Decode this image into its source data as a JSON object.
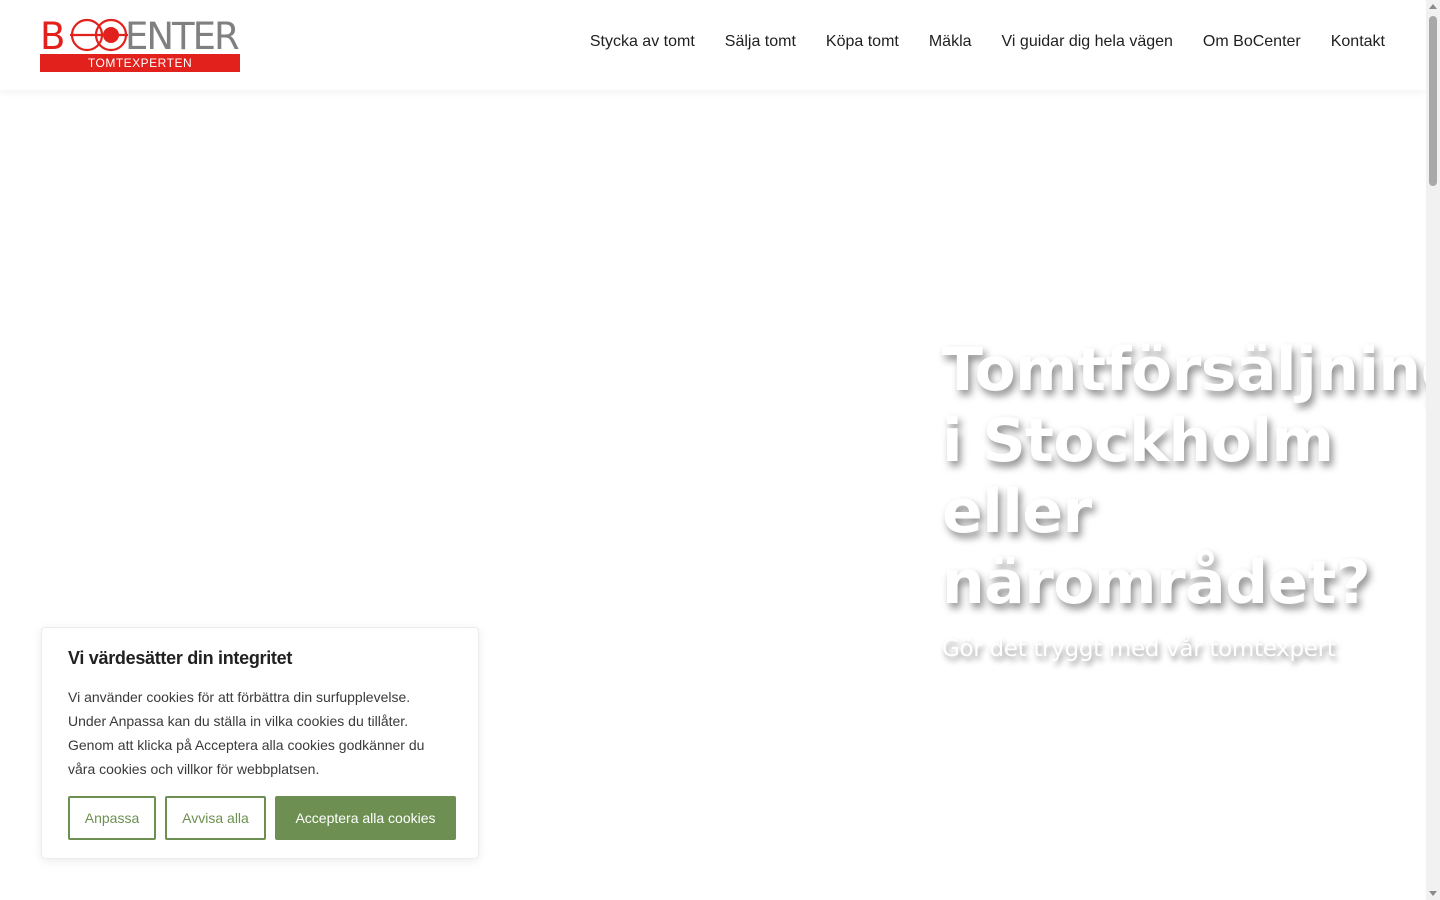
{
  "colors": {
    "brand_red": "#e3211c",
    "logo_gray": "#808080",
    "accent_green": "#6d9052",
    "nav_text": "#1f1f1f"
  },
  "logo": {
    "icon": "bocenter-logo",
    "text_main": "BOCENTER",
    "text_tag": "TOMTEXPERTEN"
  },
  "nav": {
    "items": [
      {
        "label": "Stycka av tomt"
      },
      {
        "label": "Sälja tomt"
      },
      {
        "label": "Köpa tomt"
      },
      {
        "label": "Mäkla"
      },
      {
        "label": "Vi guidar dig hela vägen"
      },
      {
        "label": "Om BoCenter"
      },
      {
        "label": "Kontakt"
      }
    ]
  },
  "hero": {
    "title_lines": [
      "Tomtförsäljning",
      "i Stockholm",
      "eller",
      "närområdet?"
    ],
    "subtitle": "Gör det tryggt med vår tomtexpert"
  },
  "cookie": {
    "title": "Vi värdesätter din integritet",
    "text": "Vi använder cookies för att förbättra din surfupplevelse. Under Anpassa kan du ställa in vilka cookies du tillåter. Genom att klicka på Acceptera alla cookies godkänner du våra cookies och villkor för webbplatsen.",
    "buttons": {
      "customize": "Anpassa",
      "reject": "Avvisa alla",
      "accept": "Acceptera alla cookies"
    }
  },
  "scrollbar": {
    "up_icon": "arrow-up-icon",
    "down_icon": "arrow-down-icon"
  }
}
